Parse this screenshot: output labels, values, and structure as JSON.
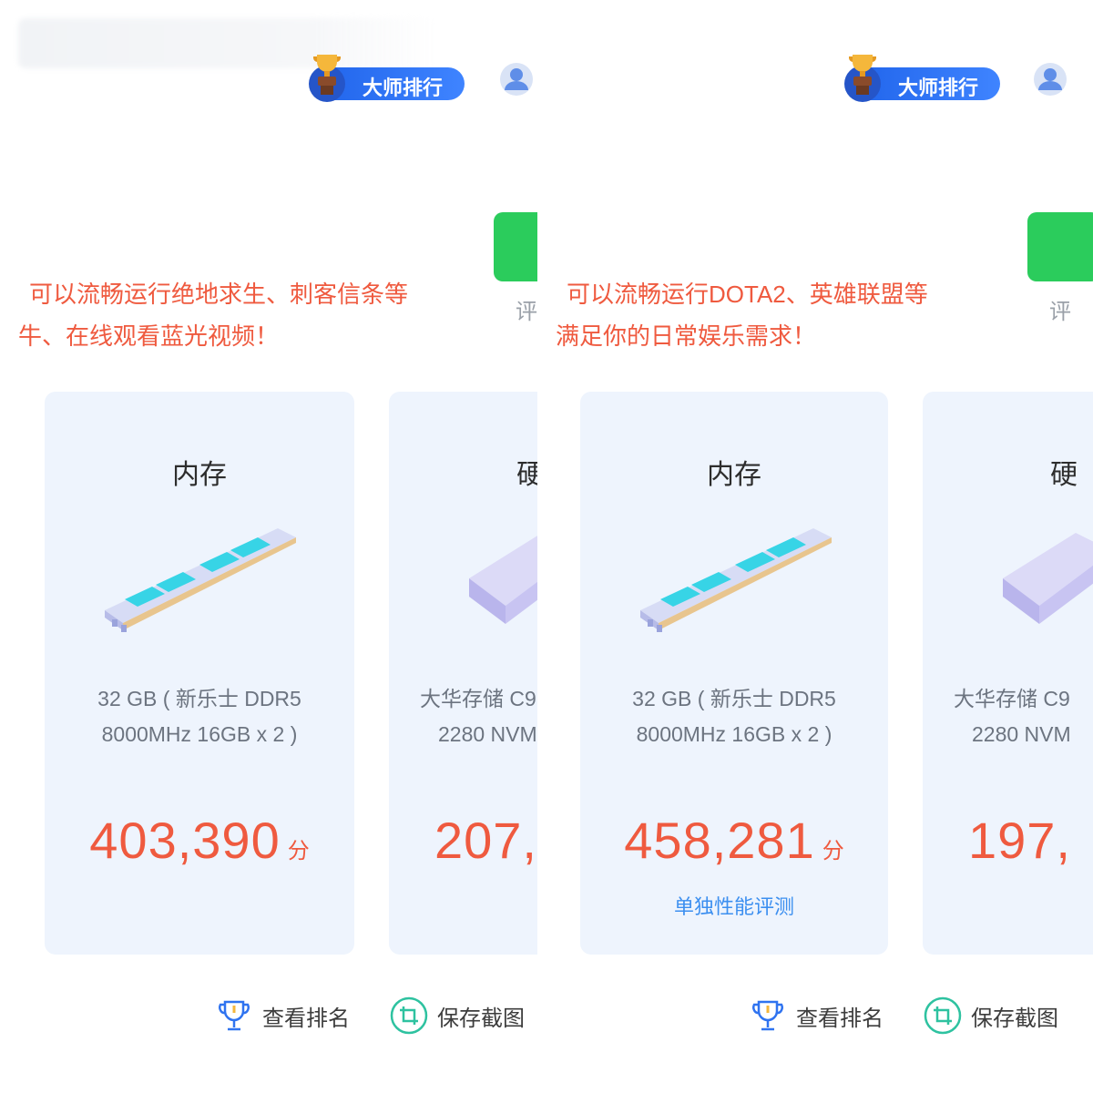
{
  "header": {
    "rank_label": "大师排行"
  },
  "left": {
    "desc_line1": "可以流畅运行绝地求生、刺客信条等",
    "desc_line2": "牛、在线观看蓝光视频！",
    "side_text": "评",
    "memory_card": {
      "title": "内存",
      "desc_line1": "32 GB ( 新乐士 DDR5",
      "desc_line2": "8000MHz 16GB x 2 )",
      "score": "403,390",
      "unit": "分"
    },
    "disk_card": {
      "title": "硬",
      "desc_line1": "大华存储 C9",
      "desc_line2": "2280 NVM",
      "score": "207,"
    }
  },
  "right": {
    "desc_line1": "可以流畅运行DOTA2、英雄联盟等",
    "desc_line2": "满足你的日常娱乐需求！",
    "side_text": "评",
    "memory_card": {
      "title": "内存",
      "desc_line1": "32 GB ( 新乐士 DDR5",
      "desc_line2": "8000MHz 16GB x 2 )",
      "score": "458,281",
      "unit": "分",
      "link": "单独性能评测"
    },
    "disk_card": {
      "title": "硬",
      "desc_line1": "大华存储 C9",
      "desc_line2": "2280 NVM",
      "score": "197,"
    }
  },
  "actions": {
    "view_rank": "查看排名",
    "save_screenshot": "保存截图"
  },
  "colors": {
    "accent_blue": "#2f73f0",
    "score_red": "#ef5a3f",
    "card_bg": "#eef4fd",
    "green": "#2bcc5c"
  },
  "icons": {
    "rank_badge": "trophy-icon",
    "avatar": "user-avatar-icon",
    "view_rank": "trophy-outline-icon",
    "save_screenshot": "crop-icon",
    "memory": "ram-module-icon",
    "disk": "ssd-icon"
  }
}
